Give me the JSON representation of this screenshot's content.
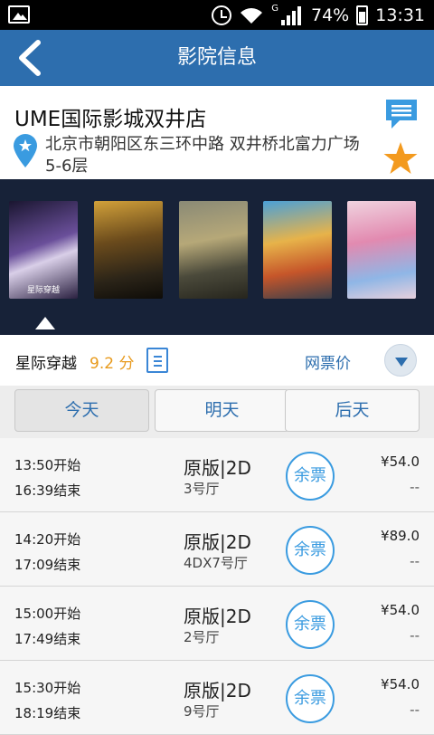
{
  "status_bar": {
    "battery": "74%",
    "time": "13:31",
    "network": "G"
  },
  "header": {
    "title": "影院信息"
  },
  "cinema": {
    "name": "UME国际影城双井店",
    "address": "北京市朝阳区东三环中路 双井桥北富力广场5-6层"
  },
  "posters": [
    {
      "title": "星际穿越",
      "color_a": "#3a2a5a",
      "color_b": "#c7b7e6"
    },
    {
      "title": "",
      "color_a": "#4b3a1a",
      "color_b": "#d1a044"
    },
    {
      "title": "",
      "color_a": "#3b3f3a",
      "color_b": "#b9ad7d"
    },
    {
      "title": "",
      "color_a": "#c05a2a",
      "color_b": "#4aa0d8"
    },
    {
      "title": "",
      "color_a": "#e9a0c0",
      "color_b": "#7ab0e0"
    }
  ],
  "movie": {
    "title": "星际穿越",
    "score": "9.2 分",
    "netprice_label": "网票价"
  },
  "tabs": [
    {
      "label": "今天",
      "active": true
    },
    {
      "label": "明天",
      "active": false
    },
    {
      "label": "后天",
      "active": false
    }
  ],
  "sessions": [
    {
      "start": "13:50开始",
      "end": "16:39结束",
      "version": "原版|2D",
      "hall": "3号厅",
      "ticket_label": "余票",
      "price": "¥54.0",
      "orig_price": "--"
    },
    {
      "start": "14:20开始",
      "end": "17:09结束",
      "version": "原版|2D",
      "hall": "4DX7号厅",
      "ticket_label": "余票",
      "price": "¥89.0",
      "orig_price": "--"
    },
    {
      "start": "15:00开始",
      "end": "17:49结束",
      "version": "原版|2D",
      "hall": "2号厅",
      "ticket_label": "余票",
      "price": "¥54.0",
      "orig_price": "--"
    },
    {
      "start": "15:30开始",
      "end": "18:19结束",
      "version": "原版|2D",
      "hall": "9号厅",
      "ticket_label": "余票",
      "price": "¥54.0",
      "orig_price": "--"
    }
  ],
  "colors": {
    "header": "#2d6eae",
    "accent": "#3a9be0",
    "score": "#e89a1c",
    "star": "#f39a1e"
  }
}
